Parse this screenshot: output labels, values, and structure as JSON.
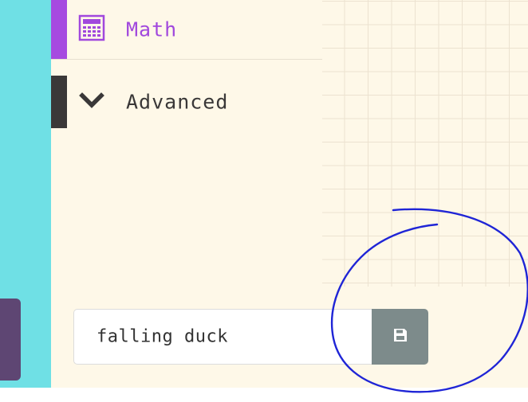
{
  "toolbox": {
    "categories": [
      {
        "label": "Math",
        "icon": "calculator-icon",
        "color": "#a64ae0"
      },
      {
        "label": "Advanced",
        "icon": "chevron-down-icon",
        "color": "#3a3838"
      }
    ]
  },
  "project": {
    "name_value": "falling duck",
    "save_icon": "floppy-disk-icon"
  },
  "colors": {
    "sidebar_strip": "#6fe0e5",
    "toolbox_bg": "#fef8e8",
    "save_button": "#7d8b8b",
    "annotation_stroke": "#1f25d6"
  }
}
